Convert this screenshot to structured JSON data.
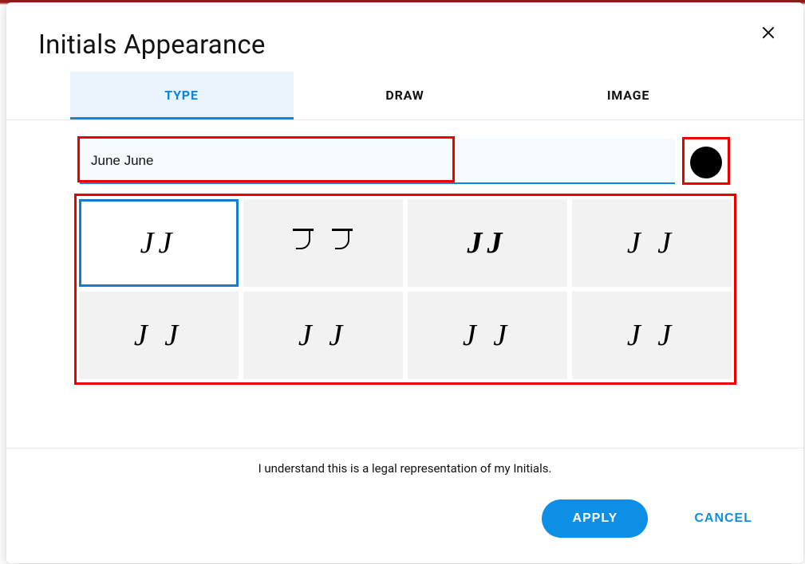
{
  "title": "Initials Appearance",
  "tabs": {
    "type": "TYPE",
    "draw": "DRAW",
    "image": "IMAGE"
  },
  "input": {
    "value": "June June"
  },
  "color": "#000000",
  "styles": {
    "items": [
      {
        "text": "JJ"
      },
      {
        "text": "J J"
      },
      {
        "text": "JJ"
      },
      {
        "text": "J J"
      },
      {
        "text": "J J"
      },
      {
        "text": "J J"
      },
      {
        "text": "J J"
      },
      {
        "text": "J  J"
      }
    ],
    "selected_index": 0
  },
  "disclaimer": "I understand this is a legal representation of my Initials.",
  "buttons": {
    "apply": "APPLY",
    "cancel": "CANCEL"
  }
}
